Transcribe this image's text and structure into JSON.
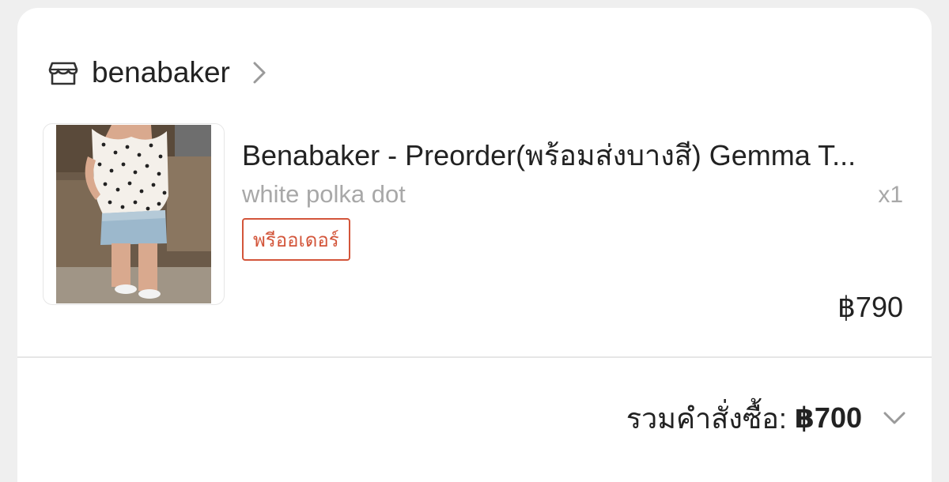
{
  "shop": {
    "name": "benabaker",
    "icon": "store-icon",
    "chevron_icon": "chevron-right-icon"
  },
  "product": {
    "title": "Benabaker - Preorder(พร้อมส่งบางสี) Gemma T...",
    "variant": "white polka dot",
    "quantity": "x1",
    "badge": "พรีออเดอร์",
    "price": "฿790",
    "image_alt": "white polka dot top with denim skirt",
    "badge_color": "#d3553a"
  },
  "order_total": {
    "label": "รวมคำสั่งซื้อ:",
    "value": "฿700",
    "expand_icon": "chevron-down-icon"
  }
}
